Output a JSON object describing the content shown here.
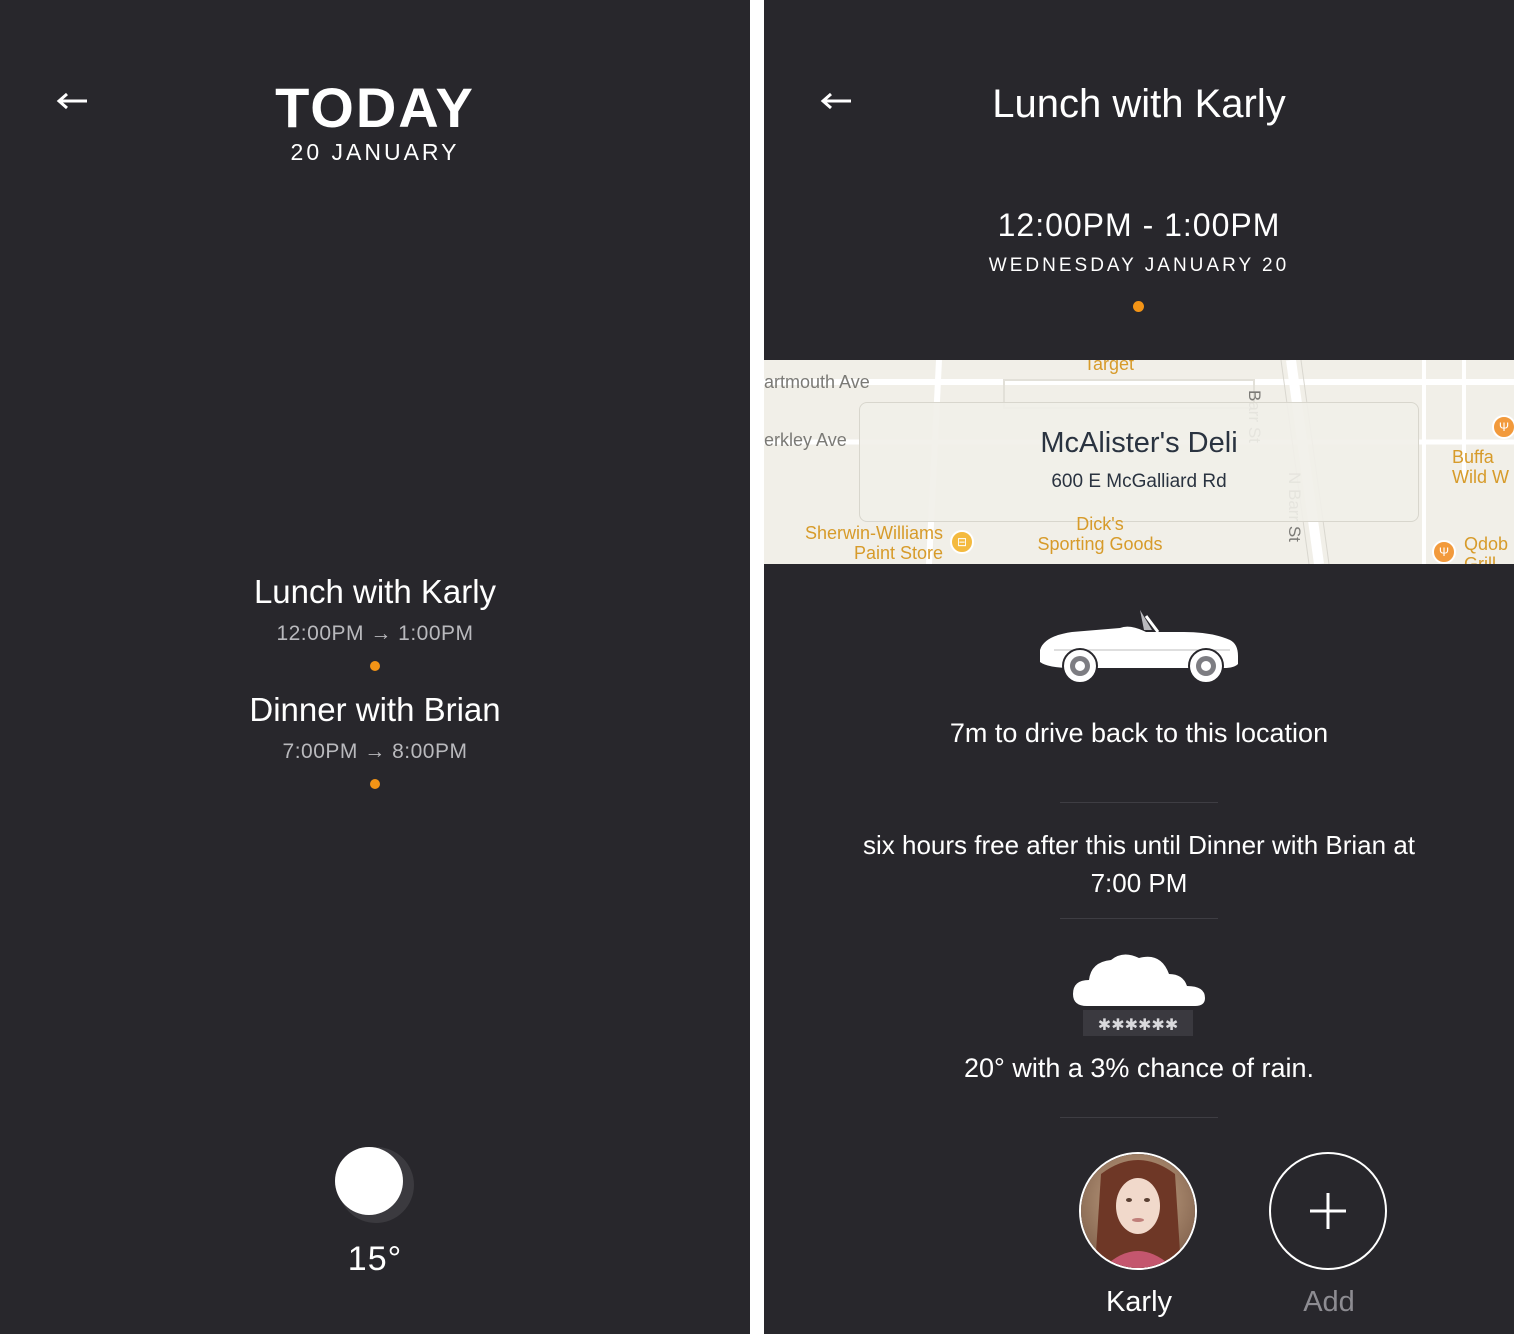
{
  "left": {
    "title": "TODAY",
    "date": "20 JANUARY",
    "events": [
      {
        "title": "Lunch with Karly",
        "time": "12:00PM → 1:00PM"
      },
      {
        "title": "Dinner with Brian",
        "time": "7:00PM → 8:00PM"
      }
    ],
    "temperature": "15°"
  },
  "right": {
    "title": "Lunch with Karly",
    "time": "12:00PM - 1:00PM",
    "date": "WEDNESDAY JANUARY 20",
    "map": {
      "venue": "McAlister's Deli",
      "address": "600 E McGalliard Rd",
      "labels": {
        "dartmouth": "artmouth Ave",
        "berkley": "erkley Ave",
        "target": "Target",
        "barr_top": "Barr St",
        "barr_side": "N Barr St",
        "sherwin_1": "Sherwin-Williams",
        "sherwin_2": "Paint Store",
        "dicks_1": "Dick's",
        "dicks_2": "Sporting Goods",
        "buffalo_1": "Buffa",
        "buffalo_2": "Wild W",
        "qdoba_1": "Qdob",
        "qdoba_2": "Grill"
      }
    },
    "drive": "7m to drive back to this location",
    "free_time": "six hours free after this until Dinner with Brian at 7:00 PM",
    "weather": "20° with a 3% chance of rain.",
    "attendees": [
      {
        "name": "Karly"
      },
      {
        "name": "Add"
      }
    ]
  },
  "colors": {
    "background": "#28272c",
    "accent": "#f39416",
    "map_background": "#f1efe8",
    "poi": "#d79b2a"
  },
  "icons": {
    "back": "left-arrow-icon",
    "moon": "moon-icon",
    "car": "car-icon",
    "weather": "snow-cloud-icon",
    "add": "plus-icon"
  }
}
